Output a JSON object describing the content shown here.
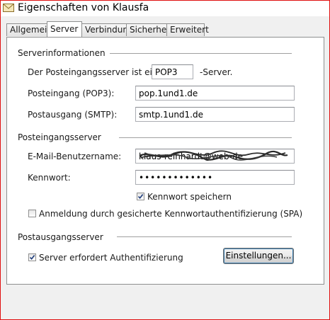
{
  "window": {
    "title": "Eigenschaften von Klausfa"
  },
  "tabs": [
    {
      "label": "Allgemein",
      "active": false
    },
    {
      "label": "Server",
      "active": true
    },
    {
      "label": "Verbindung",
      "active": false
    },
    {
      "label": "Sicherheit",
      "active": false
    },
    {
      "label": "Erweitert",
      "active": false
    }
  ],
  "server_info": {
    "group_title": "Serverinformationen",
    "incoming_type_prefix": "Der Posteingangsserver ist ein",
    "incoming_type_value": "POP3",
    "incoming_type_suffix": "-Server.",
    "incoming_label": "Posteingang (POP3):",
    "incoming_value": "pop.1und1.de",
    "outgoing_label": "Postausgang (SMTP):",
    "outgoing_value": "smtp.1und1.de"
  },
  "incoming_server": {
    "group_title": "Posteingangsserver",
    "username_label": "E-Mail-Benutzername:",
    "username_value": "klaus-reinhardt@web-de",
    "password_label": "Kennwort:",
    "password_value": "•••••••••••••",
    "remember_password_label": "Kennwort speichern",
    "remember_password_checked": true,
    "spa_label": "Anmeldung durch gesicherte Kennwortauthentifizierung (SPA)",
    "spa_checked": false
  },
  "outgoing_server": {
    "group_title": "Postausgangsserver",
    "auth_label": "Server erfordert Authentifizierung",
    "auth_checked": true,
    "settings_button": "Einstellungen..."
  },
  "colors": {
    "frame_border": "#e01010",
    "window_background": "#f0f0f0",
    "checkmark": "#1d3b7a",
    "button_focus": "#3c7fb1"
  }
}
